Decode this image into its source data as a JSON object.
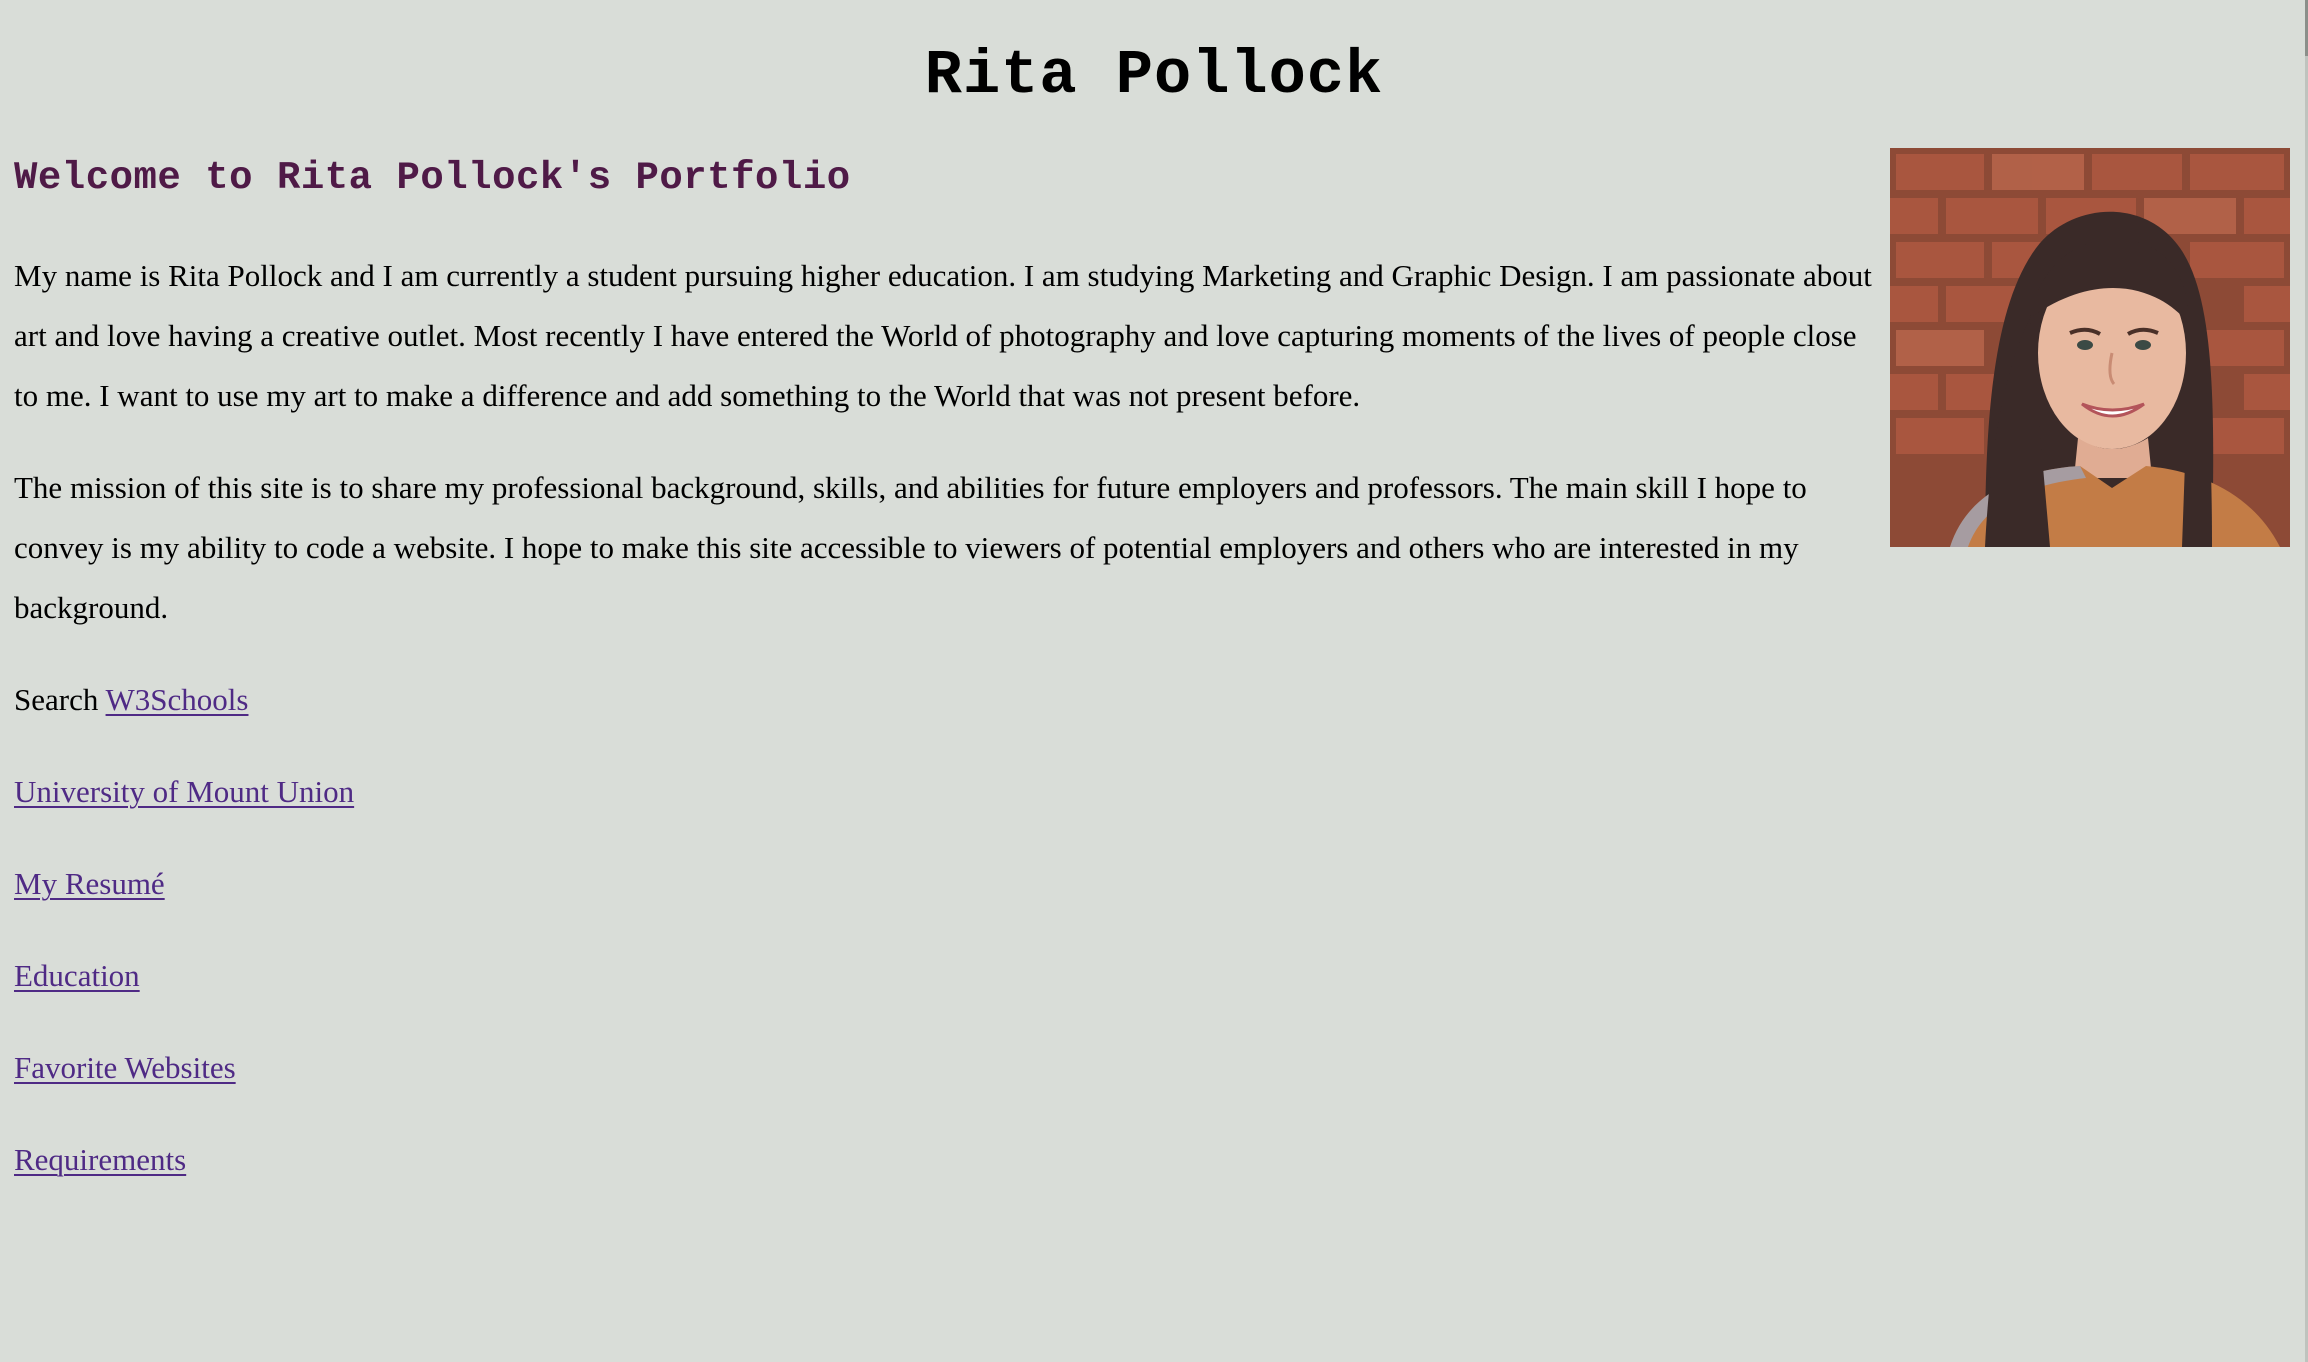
{
  "site_title": "Rita Pollock",
  "welcome_heading": "Welcome to Rita Pollock's Portfolio",
  "intro_paragraph": "My name is Rita Pollock and I am currently a student pursuing higher education. I am studying Marketing and Graphic Design. I am passionate about art and love having a creative outlet. Most recently I have entered the World of photography and love capturing moments of the lives of people close to me. I want to use my art to make a difference and add something to the World that was not present before.",
  "mission_paragraph": "The mission of this site is to share my professional background, skills, and abilities for future employers and professors. The main skill I hope to convey is my ability to code a website. I hope to make this site accessible to viewers of potential employers and others who are interested in my background.",
  "search": {
    "prefix": "Search",
    "link_label": "W3Schools"
  },
  "links": [
    {
      "label": "University of Mount Union"
    },
    {
      "label": "My Resumé"
    },
    {
      "label": "Education"
    },
    {
      "label": "Favorite Websites"
    },
    {
      "label": "Requirements"
    }
  ],
  "colors": {
    "background": "#d9ddd8",
    "heading_accent": "#4f1a47",
    "link": "#4f2a85",
    "text": "#000000"
  }
}
